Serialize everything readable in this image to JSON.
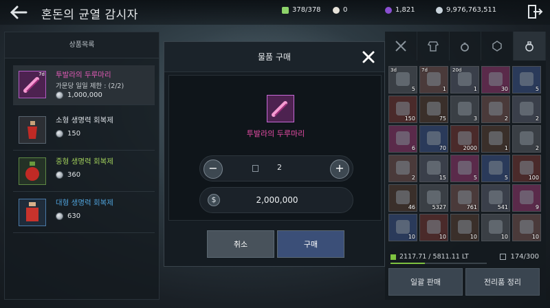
{
  "header": {
    "title": "혼돈의 균열 감시자",
    "stats": [
      {
        "icon": "energy-icon",
        "value": "378/378",
        "color": "#8dd36a"
      },
      {
        "icon": "pearl-icon",
        "value": "0",
        "color": "#e6e2da"
      },
      {
        "icon": "crystal-icon",
        "value": "1,821",
        "color": "#8a4fd1"
      },
      {
        "icon": "silver-icon",
        "value": "9,976,763,511",
        "color": "#c9d3db"
      }
    ]
  },
  "shop": {
    "heading": "상품목록",
    "items": [
      {
        "name": "투발라의 두루마리",
        "limit": "가문당 일일 제한 : (2/2)",
        "timer": "7d",
        "price": "1,000,000",
        "color": "#e05ab6"
      },
      {
        "name": "소형 생명력 회복제",
        "price": "150",
        "color": "#d8dde2"
      },
      {
        "name": "중형 생명력 회복제",
        "price": "360",
        "color": "#9ecb5a"
      },
      {
        "name": "대형 생명력 회복제",
        "price": "630",
        "color": "#4e9fd6"
      }
    ]
  },
  "modal": {
    "title": "물품 구매",
    "item_name": "투발라의 두루마리",
    "quantity": "2",
    "total": "2,000,000",
    "minus": "−",
    "plus": "+",
    "cancel_label": "취소",
    "buy_label": "구매"
  },
  "inventory": {
    "tabs": [
      "swords-icon",
      "armor-icon",
      "ring-icon",
      "gem-icon",
      "potion-bag-icon"
    ],
    "slots": [
      {
        "timer": "3d",
        "count": "5"
      },
      {
        "timer": "7d",
        "count": "1"
      },
      {
        "timer": "20d",
        "count": "1"
      },
      {
        "count": "30"
      },
      {
        "count": "5"
      },
      {
        "count": "150"
      },
      {
        "count": "75"
      },
      {
        "count": "3"
      },
      {
        "count": "2"
      },
      {
        "count": "2"
      },
      {
        "count": "6"
      },
      {
        "count": "70"
      },
      {
        "count": "2000"
      },
      {
        "count": "1"
      },
      {
        "count": "2"
      },
      {
        "count": "2"
      },
      {
        "count": "15"
      },
      {
        "count": "5"
      },
      {
        "count": "5"
      },
      {
        "count": "100"
      },
      {
        "count": "46"
      },
      {
        "count": "5327"
      },
      {
        "count": "761"
      },
      {
        "count": "541"
      },
      {
        "count": "9"
      },
      {
        "count": "10"
      },
      {
        "count": "10"
      },
      {
        "count": "10"
      },
      {
        "count": "10"
      },
      {
        "count": "10"
      }
    ],
    "weight": "2117.71 / 5811.11 LT",
    "weight_fraction": 0.36,
    "slot_usage": "174/300",
    "bulk_sell_label": "일괄 판매",
    "loot_sort_label": "전리품 정리"
  }
}
